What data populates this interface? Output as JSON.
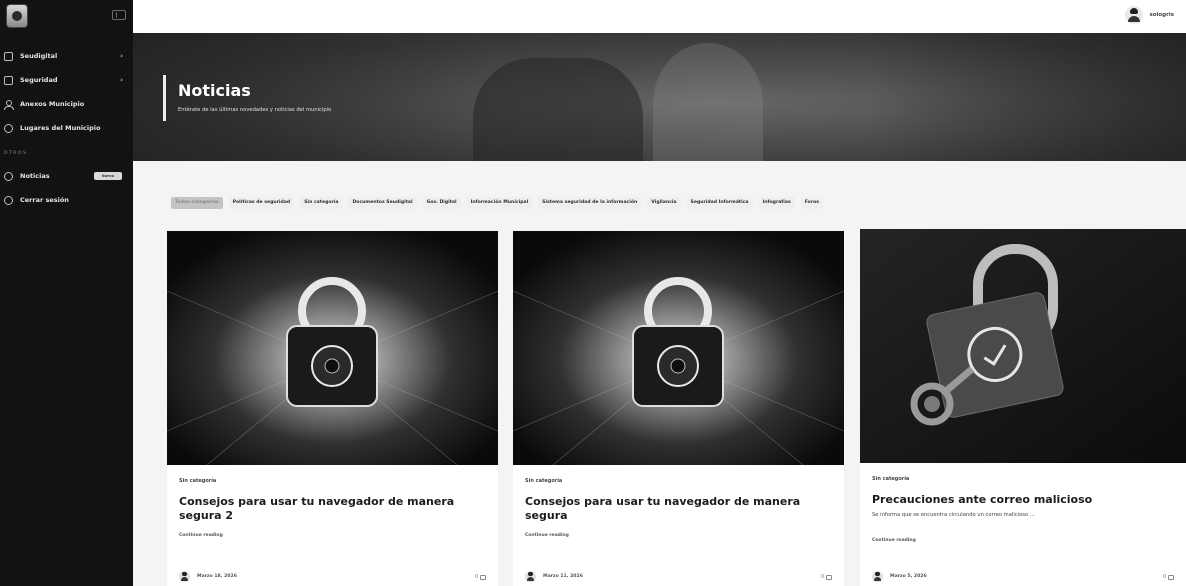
{
  "sidebar": {
    "items": [
      {
        "label": "Seudigital",
        "has_submenu": true
      },
      {
        "label": "Seguridad",
        "has_submenu": true
      },
      {
        "label": "Anexos Municipio"
      },
      {
        "label": "Lugares del Municipio"
      }
    ],
    "section_label": "OTROS",
    "secondary": [
      {
        "label": "Noticias",
        "badge": "Nuevo"
      },
      {
        "label": "Cerrar sesión"
      }
    ]
  },
  "topbar": {
    "user_name": "soiogris"
  },
  "hero": {
    "title": "Noticias",
    "subtitle": "Entérate de las últimas novedades y noticias del municipio"
  },
  "filters": [
    {
      "label": "Todas categorías",
      "active": true
    },
    {
      "label": "Políticas de seguridad"
    },
    {
      "label": "Sin categoría"
    },
    {
      "label": "Documentos Seudigital"
    },
    {
      "label": "Gov. Digital"
    },
    {
      "label": "Información Municipal"
    },
    {
      "label": "Sistema seguridad de la información"
    },
    {
      "label": "Vigilancia"
    },
    {
      "label": "Seguridad Informática"
    },
    {
      "label": "Infografías"
    },
    {
      "label": "Foros"
    }
  ],
  "posts": [
    {
      "category": "Sin categoría",
      "title": "Consejos para usar tu navegador de manera segura 2",
      "excerpt": "",
      "link": "Continue reading",
      "date": "Marzo 18, 2026",
      "comments": "0"
    },
    {
      "category": "Sin categoría",
      "title": "Consejos para usar tu navegador de manera segura",
      "excerpt": "",
      "link": "Continue reading",
      "date": "Marzo 11, 2026",
      "comments": "0"
    },
    {
      "category": "Sin categoría",
      "title": "Precauciones ante correo malicioso",
      "excerpt": "Se informa que se encuentra circulando un correo malicioso ...",
      "link": "Continue reading",
      "date": "Marzo 5, 2026",
      "comments": "0"
    }
  ]
}
